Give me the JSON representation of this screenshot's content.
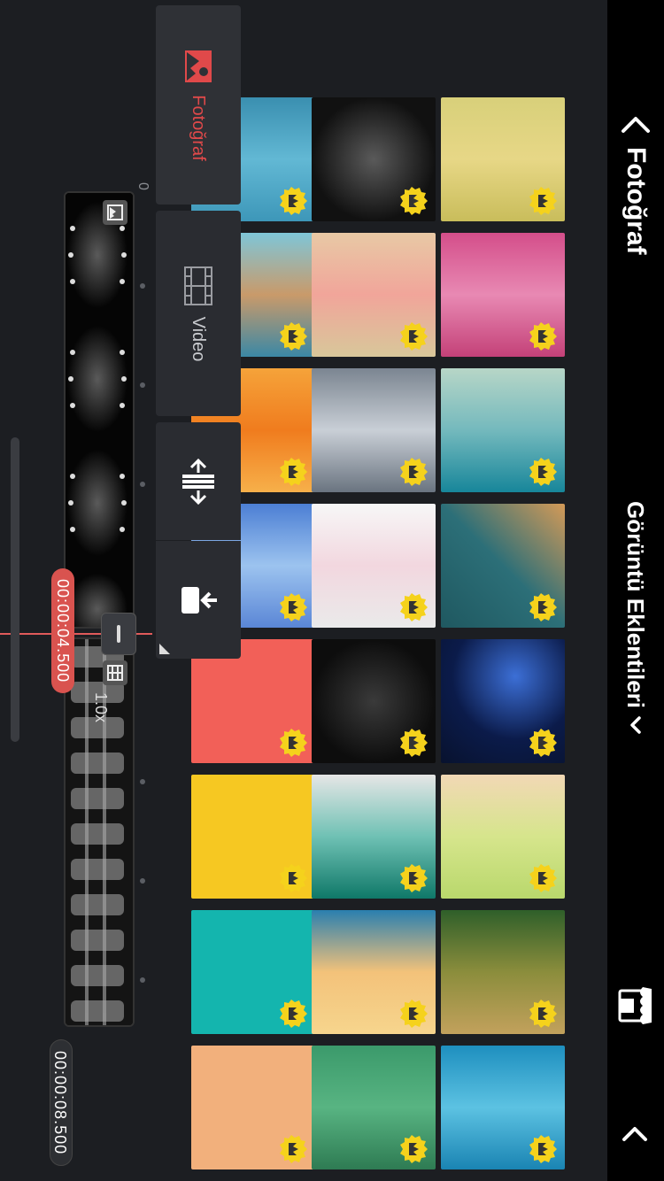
{
  "header": {
    "back_label": "Fotoğraf",
    "section_title": "Görüntü Eklentileri"
  },
  "media_tabs": {
    "photo_label": "Fotoğraf",
    "video_label": "Video"
  },
  "timeline": {
    "ruler_zero": "0",
    "current_time": "00:00:04.500",
    "total_time": "00:00:08.500",
    "speed": "1.0x"
  },
  "colors": {
    "accent_red": "#e0494a",
    "badge_yellow": "#f5d21c",
    "background": "#1c1e22"
  },
  "grid": [
    [
      {
        "bg": "linear-gradient(90deg,#3a8fb0,#62b8d4,#3d97b9)"
      },
      {
        "bg": "linear-gradient(90deg,#7fc6d8,#c99a6a,#3b88a5)"
      },
      {
        "bg": "linear-gradient(90deg,#f5a33a,#f07c1e,#f7b04a)"
      },
      {
        "bg": "linear-gradient(90deg,#4c7fd4,#9cc3ef,#5a86d6)"
      },
      {
        "bg": "#f26058"
      },
      {
        "bg": "#f6c822"
      },
      {
        "bg": "#14b5ae"
      },
      {
        "bg": "#f2b07c"
      }
    ],
    [
      {
        "bg": "radial-gradient(circle,#5a5a5a,#111 70%)"
      },
      {
        "bg": "linear-gradient(90deg,#e8c9a5,#f1a59a,#d8c79a)"
      },
      {
        "bg": "linear-gradient(90deg,#7b8591,#c9cfd6,#6a7480)"
      },
      {
        "bg": "linear-gradient(90deg,#f7f7f7,#f2d7df,#eaeaea)"
      },
      {
        "bg": "radial-gradient(circle,#3a3a3a,#0d0d0d 70%)"
      },
      {
        "bg": "linear-gradient(90deg,#e6e6e6,#6fc1b4,#0f7868)"
      },
      {
        "bg": "linear-gradient(90deg,#2a7faf,#f3c27a,#f6d58d)"
      },
      {
        "bg": "linear-gradient(90deg,#3b9a6b,#58b482,#2e7b53)"
      }
    ],
    [
      {
        "bg": "linear-gradient(90deg,#d8d07a,#e7d786,#c9bd5b)"
      },
      {
        "bg": "linear-gradient(90deg,#d44e8a,#e889b3,#c44178)"
      },
      {
        "bg": "linear-gradient(90deg,#b7d6c7,#74b9bd,#17869a)"
      },
      {
        "bg": "linear-gradient(135deg,#d49a57,#2c6f78,#1f5860)"
      },
      {
        "bg": "radial-gradient(circle at 30% 40%,#3c6fd6,#0b1b4a 55%,#08122e)"
      },
      {
        "bg": "linear-gradient(90deg,#f2d8b5,#d6e58c,#b9d86c)"
      },
      {
        "bg": "linear-gradient(90deg,#2f5f2a,#8b8d3c,#c2a15c)"
      },
      {
        "bg": "linear-gradient(90deg,#1e8fbf,#5cc2e2,#1a84b3)"
      }
    ]
  ]
}
